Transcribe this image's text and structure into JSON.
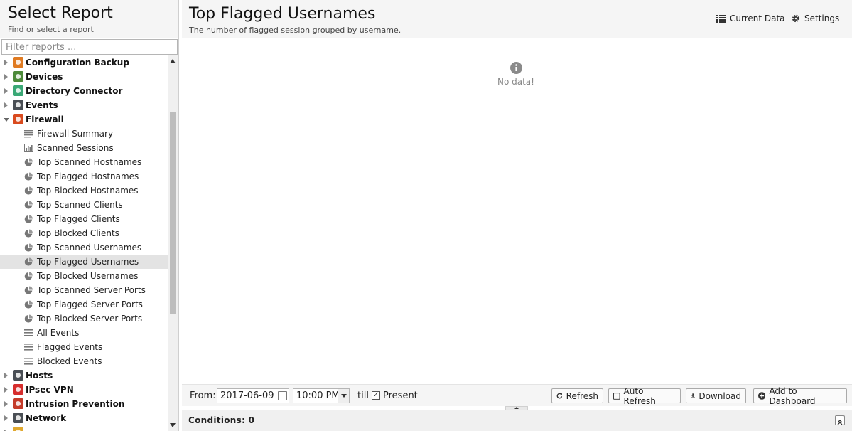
{
  "left": {
    "title": "Select Report",
    "subtitle": "Find or select a report",
    "filter_placeholder": "Filter reports ..."
  },
  "tree": [
    {
      "type": "cat",
      "label": "Configuration Backup",
      "icon": "config-backup-icon",
      "color": "#e07b22",
      "expanded": false
    },
    {
      "type": "cat",
      "label": "Devices",
      "icon": "devices-icon",
      "color": "#4d8a3a",
      "expanded": false
    },
    {
      "type": "cat",
      "label": "Directory Connector",
      "icon": "directory-connector-icon",
      "color": "#3aa876",
      "expanded": false
    },
    {
      "type": "cat",
      "label": "Events",
      "icon": "events-icon",
      "color": "#4a4f55",
      "expanded": false
    },
    {
      "type": "cat",
      "label": "Firewall",
      "icon": "firewall-icon",
      "color": "#d94a1e",
      "expanded": true
    },
    {
      "type": "leaf",
      "label": "Firewall Summary",
      "icon": "text-lines-icon"
    },
    {
      "type": "leaf",
      "label": "Scanned Sessions",
      "icon": "bar-chart-icon"
    },
    {
      "type": "leaf",
      "label": "Top Scanned Hostnames",
      "icon": "pie-chart-icon"
    },
    {
      "type": "leaf",
      "label": "Top Flagged Hostnames",
      "icon": "pie-chart-icon"
    },
    {
      "type": "leaf",
      "label": "Top Blocked Hostnames",
      "icon": "pie-chart-icon"
    },
    {
      "type": "leaf",
      "label": "Top Scanned Clients",
      "icon": "pie-chart-icon"
    },
    {
      "type": "leaf",
      "label": "Top Flagged Clients",
      "icon": "pie-chart-icon"
    },
    {
      "type": "leaf",
      "label": "Top Blocked Clients",
      "icon": "pie-chart-icon"
    },
    {
      "type": "leaf",
      "label": "Top Scanned Usernames",
      "icon": "pie-chart-icon"
    },
    {
      "type": "leaf",
      "label": "Top Flagged Usernames",
      "icon": "pie-chart-icon",
      "selected": true
    },
    {
      "type": "leaf",
      "label": "Top Blocked Usernames",
      "icon": "pie-chart-icon"
    },
    {
      "type": "leaf",
      "label": "Top Scanned Server Ports",
      "icon": "pie-chart-icon"
    },
    {
      "type": "leaf",
      "label": "Top Flagged Server Ports",
      "icon": "pie-chart-icon"
    },
    {
      "type": "leaf",
      "label": "Top Blocked Server Ports",
      "icon": "pie-chart-icon"
    },
    {
      "type": "leaf",
      "label": "All Events",
      "icon": "list-icon"
    },
    {
      "type": "leaf",
      "label": "Flagged Events",
      "icon": "list-icon"
    },
    {
      "type": "leaf",
      "label": "Blocked Events",
      "icon": "list-icon"
    },
    {
      "type": "cat",
      "label": "Hosts",
      "icon": "hosts-icon",
      "color": "#4a4f55",
      "expanded": false
    },
    {
      "type": "cat",
      "label": "IPsec VPN",
      "icon": "ipsec-vpn-icon",
      "color": "#d62d2d",
      "expanded": false
    },
    {
      "type": "cat",
      "label": "Intrusion Prevention",
      "icon": "intrusion-prevention-icon",
      "color": "#c43b2a",
      "expanded": false
    },
    {
      "type": "cat",
      "label": "Network",
      "icon": "network-icon",
      "color": "#4a4f55",
      "expanded": false
    },
    {
      "type": "cat",
      "label": "",
      "icon": "openvpn-icon",
      "color": "#e0a82e",
      "expanded": false
    }
  ],
  "main": {
    "title": "Top Flagged Usernames",
    "subtitle": "The number of flagged session grouped by username.",
    "current_data": "Current Data",
    "settings": "Settings",
    "no_data": "No data!"
  },
  "toolbar": {
    "from_label": "From:",
    "date": "2017-06-09",
    "time": "10:00 PM",
    "till_label": "till",
    "present_label": "Present",
    "present_checked": "✓",
    "refresh": "Refresh",
    "auto_refresh": "Auto Refresh",
    "download": "Download",
    "add_dashboard": "Add to Dashboard"
  },
  "conditions": {
    "label": "Conditions: 0"
  }
}
